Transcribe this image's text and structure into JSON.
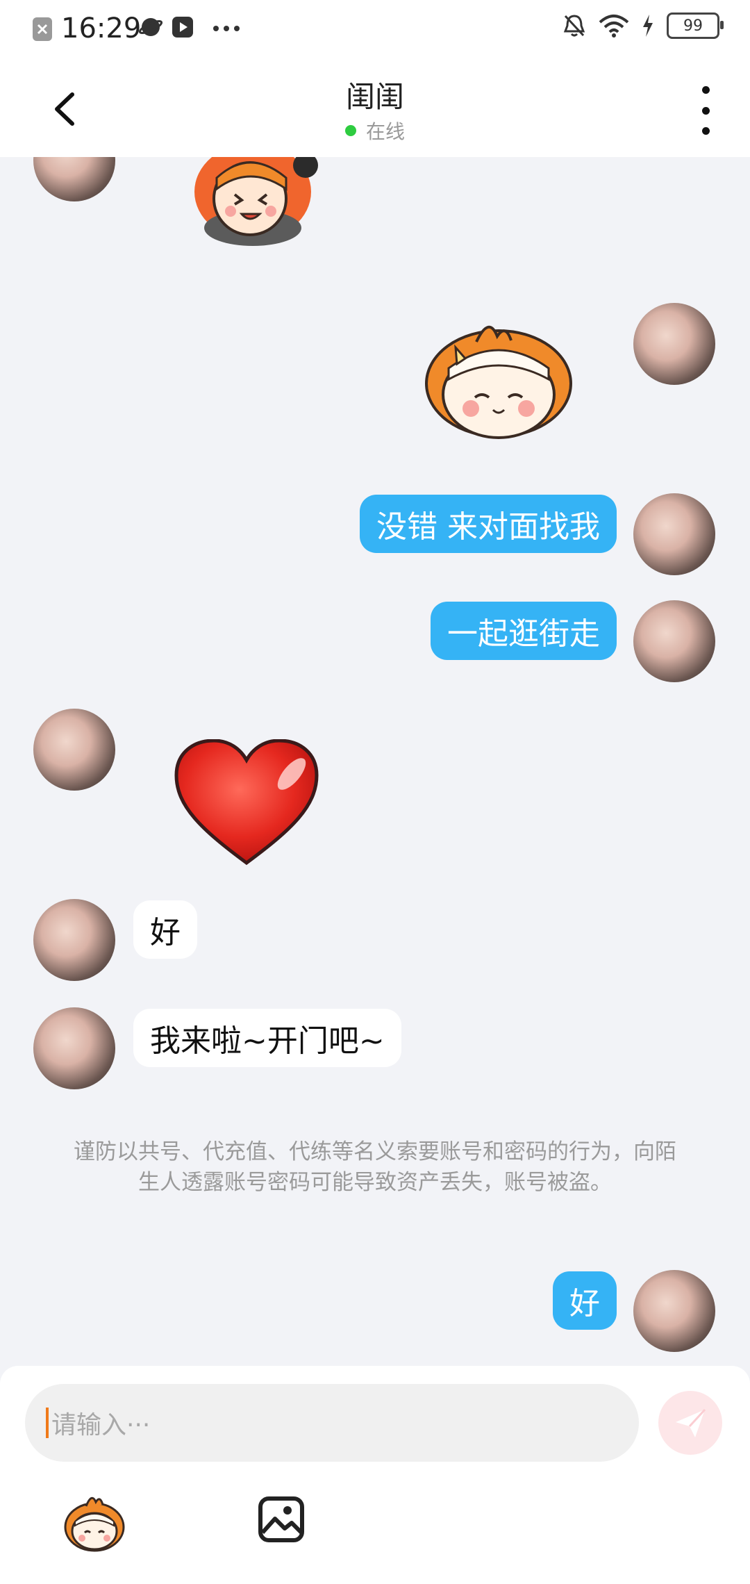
{
  "status_bar": {
    "time": "16:29",
    "battery": "99",
    "icons": [
      "close-icon",
      "planet-icon",
      "play-icon",
      "more-dots-icon",
      "bell-off-icon",
      "wifi-icon",
      "charging-icon",
      "battery-icon"
    ]
  },
  "header": {
    "title": "闺闺",
    "status": "在线",
    "status_color": "#2ecc40"
  },
  "messages": {
    "m1": "没错 来对面找我",
    "m2": "一起逛街走",
    "m3": "好",
    "m4": "我来啦~开门吧~",
    "m5": "好"
  },
  "notice": "谨防以共号、代充值、代练等名义索要账号和密码的行为，向陌生人透露账号密码可能导致资产丢失，账号被盗。",
  "composer": {
    "placeholder": "请输入···"
  },
  "colors": {
    "bubble_sent": "#35b3f5",
    "bubble_received": "#ffffff",
    "background": "#f2f3f7"
  }
}
